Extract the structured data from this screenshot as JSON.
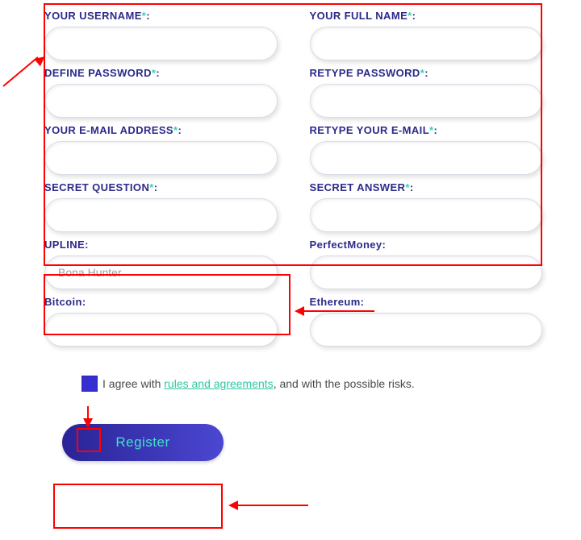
{
  "fields": {
    "username": {
      "label": "YOUR USERNAME",
      "required": true,
      "value": ""
    },
    "fullname": {
      "label": "YOUR FULL NAME",
      "required": true,
      "value": ""
    },
    "password": {
      "label": "DEFINE PASSWORD",
      "required": true,
      "value": ""
    },
    "password2": {
      "label": "RETYPE PASSWORD",
      "required": true,
      "value": ""
    },
    "email": {
      "label": "YOUR E-MAIL ADDRESS",
      "required": true,
      "value": ""
    },
    "email2": {
      "label": "RETYPE YOUR E-MAIL",
      "required": true,
      "value": ""
    },
    "secret_q": {
      "label": "SECRET QUESTION",
      "required": true,
      "value": ""
    },
    "secret_a": {
      "label": "SECRET ANSWER",
      "required": true,
      "value": ""
    },
    "upline": {
      "label": "UPLINE:",
      "required": false,
      "value": "Bona Hunter"
    },
    "perfectmoney": {
      "label": "PerfectMoney:",
      "required": false,
      "value": ""
    },
    "bitcoin": {
      "label": "Bitcoin:",
      "required": false,
      "value": ""
    },
    "ethereum": {
      "label": "Ethereum:",
      "required": false,
      "value": ""
    }
  },
  "asterisk": "*",
  "colon": ":",
  "agree": {
    "pre": "I agree with ",
    "link": "rules and agreements",
    "post": ", and with the possible risks.",
    "checked": true
  },
  "register_label": "Register"
}
